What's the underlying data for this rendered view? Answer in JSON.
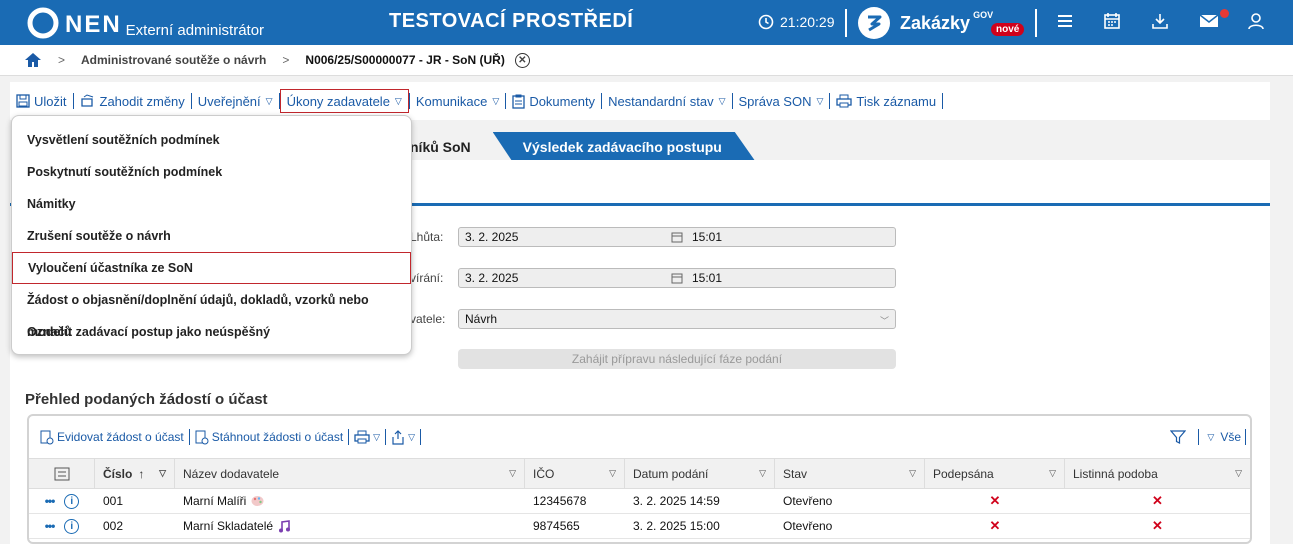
{
  "header": {
    "brand": "NEN",
    "role": "Externí administrátor",
    "environment": "TESTOVACÍ PROSTŘEDÍ",
    "time": "21:20:29",
    "zakazky": "Zakázky",
    "gov": "GOV",
    "nove_badge": "nové",
    "icons": [
      "menu-icon",
      "calendar-icon",
      "download-icon",
      "mail-icon",
      "user-icon"
    ]
  },
  "breadcrumb": {
    "items": [
      "Administrované soutěže o návrh",
      "N006/25/S00000077 - JR - SoN (UŘ)"
    ]
  },
  "toolbar": {
    "save": "Uložit",
    "discard": "Zahodit změny",
    "publish": "Uveřejnění",
    "acts": "Úkony zadavatele",
    "communication": "Komunikace",
    "documents": "Dokumenty",
    "nonstandard": "Nestandardní stav",
    "manage": "Správa SON",
    "print": "Tisk záznamu"
  },
  "dropdown": {
    "items": [
      "Vysvětlení soutěžních podmínek",
      "Poskytnutí soutěžních podmínek",
      "Námitky",
      "Zrušení soutěže o návrh",
      "Vyloučení účastníka ze SoN",
      "Žádost o objasnění/doplnění údajů, dokladů, vzorků nebo modelů",
      "Označit zadávací postup jako neúspěšný"
    ]
  },
  "tabs": {
    "partial": "níků SoN",
    "result": "Výsledek zadávacího postupu"
  },
  "form": {
    "deadline_label": "Lhůta:",
    "deadline_date": "3. 2. 2025",
    "deadline_time": "15:01",
    "opening_label": "vírání:",
    "opening_date": "3. 2. 2025",
    "opening_time": "15:01",
    "type_label": "vatele:",
    "type_value": "Návrh",
    "next_phase_button": "Zahájit přípravu následující fáze podání"
  },
  "section": {
    "title": "Přehled podaných žádostí o účast"
  },
  "grid": {
    "toolbar": {
      "record": "Evidovat žádost o účast",
      "download": "Stáhnout žádosti o účast",
      "all": "Vše"
    },
    "columns": [
      "Číslo",
      "Název dodavatele",
      "IČO",
      "Datum podání",
      "Stav",
      "Podepsána",
      "Listinná podoba"
    ],
    "rows": [
      {
        "number": "001",
        "supplier": "Marní Malíři",
        "ico": "12345678",
        "date": "3. 2. 2025 14:59",
        "state": "Otevřeno",
        "signed": "✕",
        "paper": "✕"
      },
      {
        "number": "002",
        "supplier": "Marní Skladatelé",
        "ico": "9874565",
        "date": "3. 2. 2025 15:00",
        "state": "Otevřeno",
        "signed": "✕",
        "paper": "✕"
      }
    ]
  }
}
